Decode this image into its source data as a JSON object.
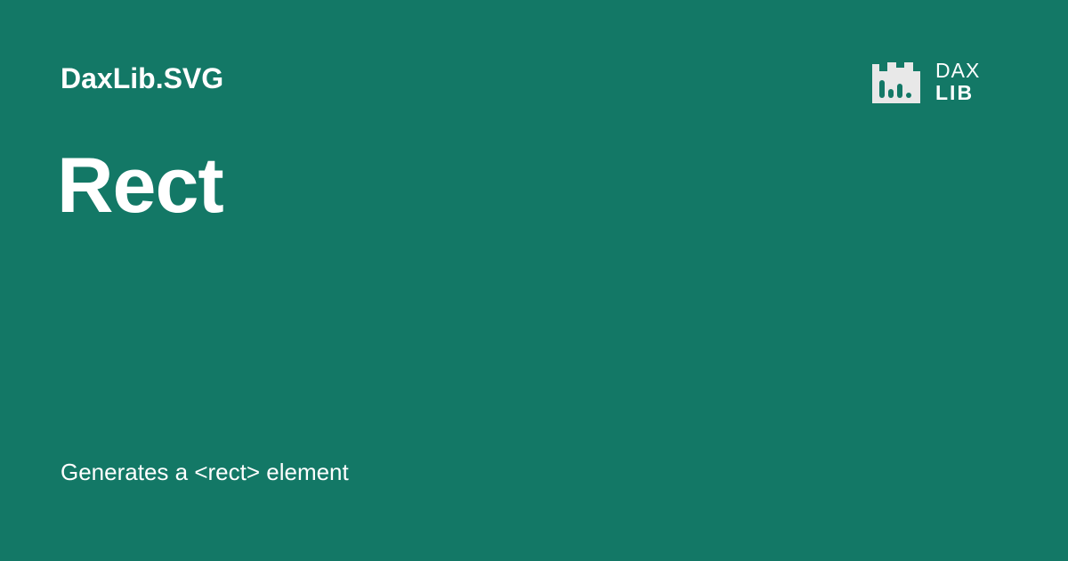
{
  "colors": {
    "background": "#137866",
    "text": "#ffffff",
    "logo_mark": "#e8e8e8",
    "logo_mark_bars": "#137866"
  },
  "header": {
    "library_name": "DaxLib.SVG"
  },
  "main": {
    "title": "Rect",
    "description": "Generates a <rect> element"
  },
  "logo": {
    "icon": "daxlib-castle-chart-icon",
    "line1": "DAX",
    "line2": "LIB"
  }
}
